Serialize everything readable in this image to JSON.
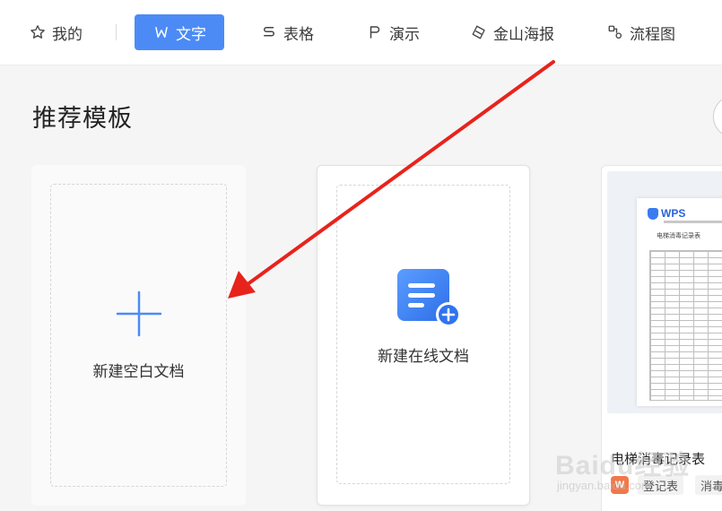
{
  "nav": {
    "items": [
      {
        "label": "我的",
        "icon": "star-icon"
      },
      {
        "label": "文字",
        "icon": "word-icon",
        "active": true
      },
      {
        "label": "表格",
        "icon": "sheet-icon"
      },
      {
        "label": "演示",
        "icon": "presentation-icon"
      },
      {
        "label": "金山海报",
        "icon": "poster-icon"
      },
      {
        "label": "流程图",
        "icon": "flowchart-icon"
      }
    ]
  },
  "section": {
    "title": "推荐模板"
  },
  "cards": {
    "blank": {
      "label": "新建空白文档"
    },
    "online": {
      "label": "新建在线文档"
    },
    "template": {
      "name": "电梯消毒记录表",
      "logo_text": "WPS",
      "paper_title": "电梯消毒记录表",
      "tags": [
        "登记表",
        "消毒"
      ]
    }
  },
  "watermark": {
    "text": "Baidu经验",
    "sub": "jingyan.baidu.com"
  },
  "colors": {
    "accent": "#4c8bf5",
    "arrow": "#e8231c"
  }
}
